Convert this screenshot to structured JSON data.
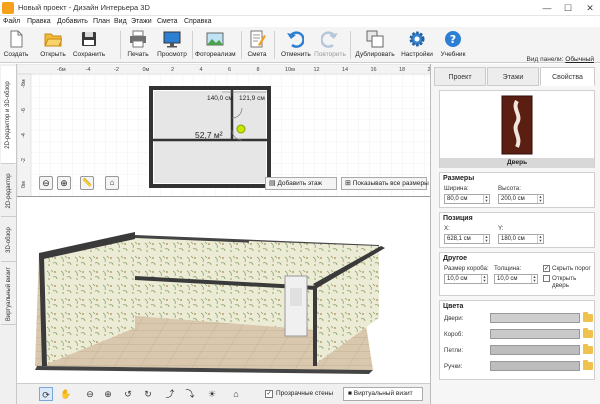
{
  "window": {
    "title": "Новый проект - Дизайн Интерьера 3D",
    "min": "—",
    "max": "☐",
    "close": "✕"
  },
  "menu": [
    "Файл",
    "Правка",
    "Добавить",
    "План",
    "Вид",
    "Этажи",
    "Смета",
    "Справка"
  ],
  "toolbar": {
    "create": "Создать",
    "open": "Открыть",
    "save": "Сохранить",
    "print": "Печать",
    "preview": "Просмотр",
    "photorealism": "Фотореализм",
    "estimate": "Смета",
    "undo": "Отменить",
    "redo": "Повторить",
    "duplicate": "Дублировать",
    "settings": "Настройки",
    "tutorial": "Учебник"
  },
  "view_panel": {
    "label": "Вид панели:",
    "value": "Обычный"
  },
  "left_tabs": [
    "2D-редактор и 3D-обзор",
    "2D-редактор",
    "3D-обзор",
    "Виртуальный визит"
  ],
  "plan": {
    "ruler_x": [
      "-6м",
      "-4",
      "-2",
      "0м",
      "2",
      "4",
      "6",
      "8",
      "10м",
      "12",
      "14",
      "16",
      "18",
      "20м"
    ],
    "ruler_y": [
      "-8м",
      "-6",
      "-4",
      "-2",
      "0м"
    ],
    "dim_width": "140,0 см",
    "dim_height": "121,9 см",
    "area_label": "52,7 м²",
    "add_floor": "Добавить этаж",
    "show_all_dims": "Показывать все размеры"
  },
  "bottom": {
    "transparent_walls": "Прозрачные стены",
    "virtual_visit": "Виртуальный визит"
  },
  "right_panel": {
    "tabs": [
      "Проект",
      "Этажи",
      "Свойства"
    ],
    "object_name": "Дверь",
    "sizes": {
      "header": "Размеры",
      "width_label": "Ширина:",
      "width_value": "80,0 см",
      "height_label": "Высота:",
      "height_value": "200,0 см"
    },
    "position": {
      "header": "Позиция",
      "x_label": "X:",
      "x_value": "628,1 см",
      "y_label": "Y:",
      "y_value": "180,0 см"
    },
    "other": {
      "header": "Другое",
      "frame_label": "Размер короба:",
      "frame_value": "10,0 см",
      "thickness_label": "Толщина:",
      "thickness_value": "10,0 см",
      "hide_threshold": "Скрыть порог",
      "open_door": "Открыть дверь"
    },
    "colors": {
      "header": "Цвета",
      "door": "Двери:",
      "frame": "Короб:",
      "hinges": "Петли:",
      "handles": "Ручки:"
    }
  }
}
